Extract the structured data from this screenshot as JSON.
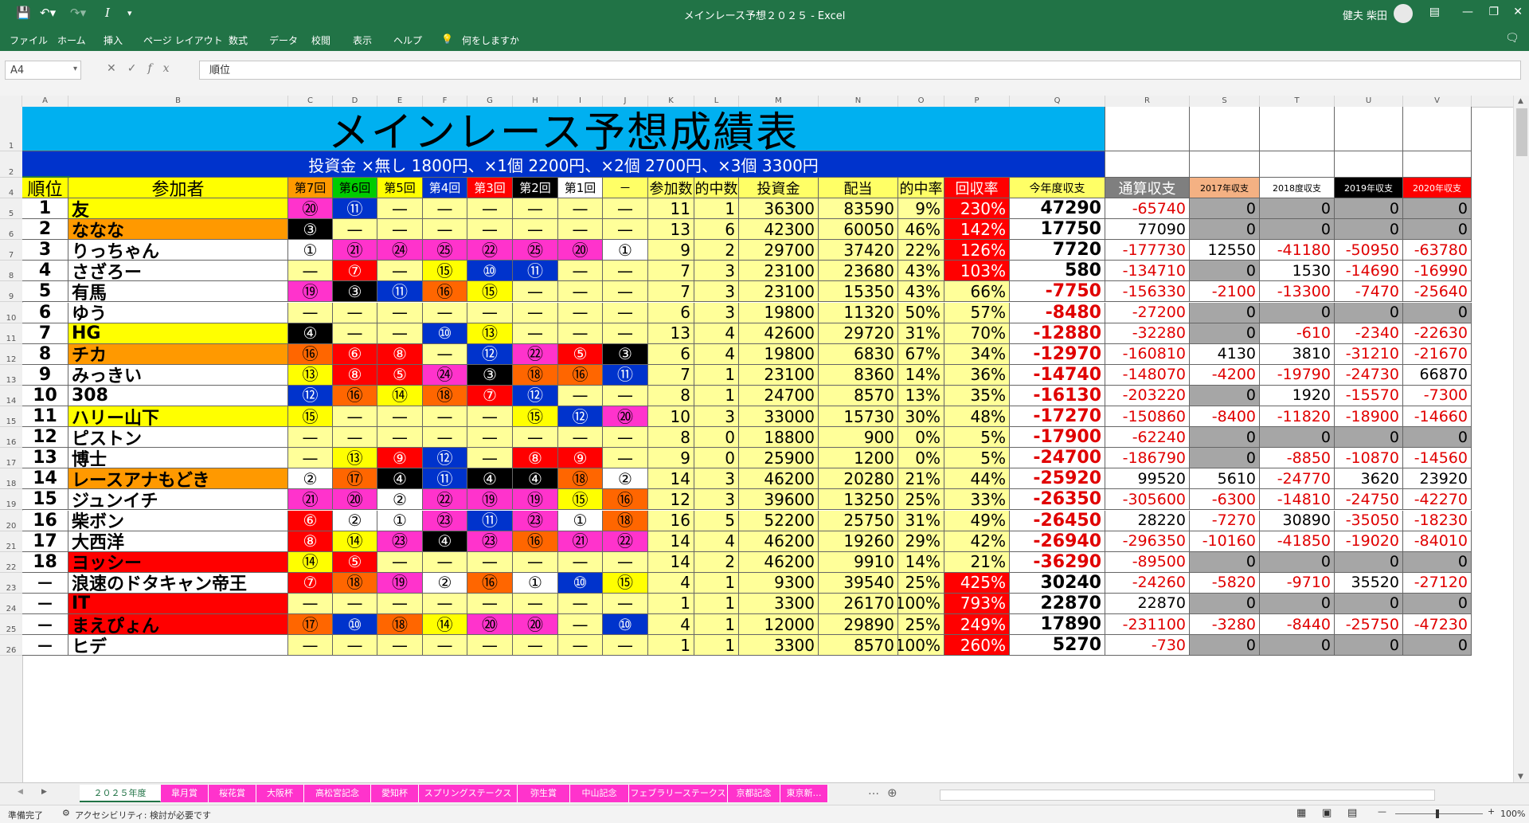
{
  "app": {
    "window_title": "メインレース予想２０２５ - Excel",
    "user_name": "健夫 柴田",
    "qa_icons": [
      "save-icon",
      "undo-icon",
      "redo-icon",
      "italic-icon",
      "customize-icon"
    ]
  },
  "ribbon": {
    "tabs": [
      "ファイル",
      "ホーム",
      "挿入",
      "ページ レイアウト",
      "数式",
      "データ",
      "校閲",
      "表示",
      "ヘルプ"
    ],
    "tell_me": "何をしますか"
  },
  "formula_bar": {
    "name_box": "A4",
    "content": "順位"
  },
  "columns": [
    {
      "l": "A",
      "w": 58
    },
    {
      "l": "B",
      "w": 276
    },
    {
      "l": "C",
      "w": 56
    },
    {
      "l": "D",
      "w": 56
    },
    {
      "l": "E",
      "w": 57
    },
    {
      "l": "F",
      "w": 56
    },
    {
      "l": "G",
      "w": 57
    },
    {
      "l": "H",
      "w": 57
    },
    {
      "l": "I",
      "w": 56
    },
    {
      "l": "J",
      "w": 57
    },
    {
      "l": "K",
      "w": 58
    },
    {
      "l": "L",
      "w": 56
    },
    {
      "l": "M",
      "w": 100
    },
    {
      "l": "N",
      "w": 100
    },
    {
      "l": "O",
      "w": 58
    },
    {
      "l": "P",
      "w": 82
    },
    {
      "l": "Q",
      "w": 120
    },
    {
      "l": "R",
      "w": 106
    },
    {
      "l": "S",
      "w": 88
    },
    {
      "l": "T",
      "w": 94
    },
    {
      "l": "U",
      "w": 86
    },
    {
      "l": "V",
      "w": 86
    }
  ],
  "row_numbers": [
    "1",
    "2",
    "4",
    "5",
    "6",
    "7",
    "8",
    "9",
    "10",
    "11",
    "12",
    "13",
    "14",
    "15",
    "16",
    "17",
    "18",
    "19",
    "20",
    "21",
    "22",
    "23",
    "24",
    "25",
    "26"
  ],
  "sheet_title": "メインレース予想成績表",
  "invest_line": "投資金 ×無し 1800円、×1個 2200円、×2個 2700円、×3個 3300円",
  "headers": [
    "順位",
    "参加者",
    "第7回",
    "第6回",
    "第5回",
    "第4回",
    "第3回",
    "第2回",
    "第1回",
    "－",
    "参加数",
    "的中数",
    "投資金",
    "配当",
    "的中率",
    "回収率",
    "今年度収支",
    "通算収支",
    "2017年収支",
    "2018度収支",
    "2019年収支",
    "2020年収支"
  ],
  "header_colors": {
    "bg": [
      "#ffff00",
      "#ffff00",
      "#ff9900",
      "#00cc00",
      "#ffff00",
      "#0033cc",
      "#ff0000",
      "#000000",
      "#ffffff",
      "#ffff66",
      "#ffff66",
      "#ffff66",
      "#ffff66",
      "#ffff66",
      "#ffff66",
      "#ff0000",
      "#ffff66",
      "#7f7f7f",
      "#f4b183",
      "#ffffff",
      "#000000",
      "#ff0000"
    ],
    "fg": [
      "#000000",
      "#000000",
      "#000000",
      "#000000",
      "#000000",
      "#ffffff",
      "#ffffff",
      "#ffffff",
      "#000000",
      "#000000",
      "#000000",
      "#000000",
      "#000000",
      "#000000",
      "#000000",
      "#ffffff",
      "#000000",
      "#ffffff",
      "#000000",
      "#000000",
      "#ffffff",
      "#ffffff"
    ]
  },
  "badge_colors": {
    "①": "#ffffff",
    "②": "#ffffff",
    "③": "#000000",
    "④": "#000000",
    "⑤": "#ff0000",
    "⑥": "#ff0000",
    "⑦": "#ff0000",
    "⑧": "#ff0000",
    "⑨": "#ff0000",
    "⑩": "#0033cc",
    "⑪": "#0033cc",
    "⑫": "#0033cc",
    "⑬": "#ffff00",
    "⑭": "#ffff00",
    "⑮": "#ffff00",
    "⑯": "#ff6600",
    "⑰": "#ff6600",
    "⑱": "#ff6600",
    "⑲": "#ff33cc",
    "⑳": "#ff33cc",
    "㉑": "#ff33cc",
    "㉒": "#ff33cc",
    "㉓": "#ff33cc",
    "㉔": "#ff33cc",
    "㉕": "#ff33cc"
  },
  "rows": [
    {
      "rank": "1",
      "name": "友",
      "name_bg": "#ffff00",
      "races": [
        "⑳",
        "⑪",
        "—",
        "—",
        "—",
        "—",
        "—",
        "—"
      ],
      "entries": "11",
      "hits": "1",
      "invest": "36300",
      "payout": "83590",
      "hit_rate": "9%",
      "recovery": "230%",
      "rec_red": true,
      "year": "47290",
      "total": "-65740",
      "y2017": "0",
      "y2018": "0",
      "y2019": "0",
      "y2020": "0",
      "grey": [
        1,
        1,
        1,
        1
      ]
    },
    {
      "rank": "2",
      "name": "ななな",
      "name_bg": "#ff9900",
      "races": [
        "③",
        "—",
        "—",
        "—",
        "—",
        "—",
        "—",
        "—"
      ],
      "entries": "13",
      "hits": "6",
      "invest": "42300",
      "payout": "60050",
      "hit_rate": "46%",
      "recovery": "142%",
      "rec_red": true,
      "year": "17750",
      "total": "77090",
      "y2017": "0",
      "y2018": "0",
      "y2019": "0",
      "y2020": "0",
      "grey": [
        1,
        1,
        1,
        1
      ]
    },
    {
      "rank": "3",
      "name": "りっちゃん",
      "name_bg": "#ffffff",
      "races": [
        "①",
        "㉑",
        "㉔",
        "㉕",
        "㉒",
        "㉕",
        "⑳",
        "①"
      ],
      "entries": "9",
      "hits": "2",
      "invest": "29700",
      "payout": "37420",
      "hit_rate": "22%",
      "recovery": "126%",
      "rec_red": true,
      "year": "7720",
      "total": "-177730",
      "y2017": "12550",
      "y2018": "-41180",
      "y2019": "-50950",
      "y2020": "-63780",
      "grey": [
        0,
        0,
        0,
        0
      ]
    },
    {
      "rank": "4",
      "name": "さざろー",
      "name_bg": "#ffffff",
      "races": [
        "—",
        "⑦",
        "—",
        "⑮",
        "⑩",
        "⑪",
        "—",
        "—"
      ],
      "entries": "7",
      "hits": "3",
      "invest": "23100",
      "payout": "23680",
      "hit_rate": "43%",
      "recovery": "103%",
      "rec_red": true,
      "year": "580",
      "total": "-134710",
      "y2017": "0",
      "y2018": "1530",
      "y2019": "-14690",
      "y2020": "-16990",
      "grey": [
        1,
        0,
        0,
        0
      ]
    },
    {
      "rank": "5",
      "name": "有馬",
      "name_bg": "#ffffff",
      "races": [
        "⑲",
        "③",
        "⑪",
        "⑯",
        "⑮",
        "—",
        "—",
        "—"
      ],
      "entries": "7",
      "hits": "3",
      "invest": "23100",
      "payout": "15350",
      "hit_rate": "43%",
      "recovery": "66%",
      "rec_red": false,
      "year": "-7750",
      "total": "-156330",
      "y2017": "-2100",
      "y2018": "-13300",
      "y2019": "-7470",
      "y2020": "-25640",
      "grey": [
        0,
        0,
        0,
        0
      ]
    },
    {
      "rank": "6",
      "name": "ゆう",
      "name_bg": "#ffffff",
      "races": [
        "—",
        "—",
        "—",
        "—",
        "—",
        "—",
        "—",
        "—"
      ],
      "entries": "6",
      "hits": "3",
      "invest": "19800",
      "payout": "11320",
      "hit_rate": "50%",
      "recovery": "57%",
      "rec_red": false,
      "year": "-8480",
      "total": "-27200",
      "y2017": "0",
      "y2018": "0",
      "y2019": "0",
      "y2020": "0",
      "grey": [
        1,
        1,
        1,
        1
      ]
    },
    {
      "rank": "7",
      "name": "HG",
      "name_bg": "#ffff00",
      "races": [
        "④",
        "—",
        "—",
        "⑩",
        "⑬",
        "—",
        "—",
        "—"
      ],
      "entries": "13",
      "hits": "4",
      "invest": "42600",
      "payout": "29720",
      "hit_rate": "31%",
      "recovery": "70%",
      "rec_red": false,
      "year": "-12880",
      "total": "-32280",
      "y2017": "0",
      "y2018": "-610",
      "y2019": "-2340",
      "y2020": "-22630",
      "grey": [
        1,
        0,
        0,
        0
      ]
    },
    {
      "rank": "8",
      "name": "チカ",
      "name_bg": "#ff9900",
      "races": [
        "⑯",
        "⑥",
        "⑧",
        "—",
        "⑫",
        "㉒",
        "⑤",
        "③"
      ],
      "entries": "6",
      "hits": "4",
      "invest": "19800",
      "payout": "6830",
      "hit_rate": "67%",
      "recovery": "34%",
      "rec_red": false,
      "year": "-12970",
      "total": "-160810",
      "y2017": "4130",
      "y2018": "3810",
      "y2019": "-31210",
      "y2020": "-21670",
      "grey": [
        0,
        0,
        0,
        0
      ]
    },
    {
      "rank": "9",
      "name": "みっきい",
      "name_bg": "#ffffff",
      "races": [
        "⑬",
        "⑧",
        "⑤",
        "㉔",
        "③",
        "⑱",
        "⑯",
        "⑪"
      ],
      "entries": "7",
      "hits": "1",
      "invest": "23100",
      "payout": "8360",
      "hit_rate": "14%",
      "recovery": "36%",
      "rec_red": false,
      "year": "-14740",
      "total": "-148070",
      "y2017": "-4200",
      "y2018": "-19790",
      "y2019": "-24730",
      "y2020": "66870",
      "grey": [
        0,
        0,
        0,
        0
      ]
    },
    {
      "rank": "10",
      "name": "308",
      "name_bg": "#ffffff",
      "races": [
        "⑫",
        "⑯",
        "⑭",
        "⑱",
        "⑦",
        "⑫",
        "—",
        "—"
      ],
      "entries": "8",
      "hits": "1",
      "invest": "24700",
      "payout": "8570",
      "hit_rate": "13%",
      "recovery": "35%",
      "rec_red": false,
      "year": "-16130",
      "total": "-203220",
      "y2017": "0",
      "y2018": "1920",
      "y2019": "-15570",
      "y2020": "-7300",
      "grey": [
        1,
        0,
        0,
        0
      ]
    },
    {
      "rank": "11",
      "name": "ハリー山下",
      "name_bg": "#ffff00",
      "races": [
        "⑮",
        "—",
        "—",
        "—",
        "—",
        "⑮",
        "⑫",
        "⑳"
      ],
      "entries": "10",
      "hits": "3",
      "invest": "33000",
      "payout": "15730",
      "hit_rate": "30%",
      "recovery": "48%",
      "rec_red": false,
      "year": "-17270",
      "total": "-150860",
      "y2017": "-8400",
      "y2018": "-11820",
      "y2019": "-18900",
      "y2020": "-14660",
      "grey": [
        0,
        0,
        0,
        0
      ]
    },
    {
      "rank": "12",
      "name": "ピストン",
      "name_bg": "#ffffff",
      "races": [
        "—",
        "—",
        "—",
        "—",
        "—",
        "—",
        "—",
        "—"
      ],
      "entries": "8",
      "hits": "0",
      "invest": "18800",
      "payout": "900",
      "hit_rate": "0%",
      "recovery": "5%",
      "rec_red": false,
      "year": "-17900",
      "total": "-62240",
      "y2017": "0",
      "y2018": "0",
      "y2019": "0",
      "y2020": "0",
      "grey": [
        1,
        1,
        1,
        1
      ]
    },
    {
      "rank": "13",
      "name": "博士",
      "name_bg": "#ffffff",
      "races": [
        "—",
        "⑬",
        "⑨",
        "⑫",
        "—",
        "⑧",
        "⑨",
        "—"
      ],
      "entries": "9",
      "hits": "0",
      "invest": "25900",
      "payout": "1200",
      "hit_rate": "0%",
      "recovery": "5%",
      "rec_red": false,
      "year": "-24700",
      "total": "-186790",
      "y2017": "0",
      "y2018": "-8850",
      "y2019": "-10870",
      "y2020": "-14560",
      "grey": [
        1,
        0,
        0,
        0
      ]
    },
    {
      "rank": "14",
      "name": "レースアナもどき",
      "name_bg": "#ff9900",
      "races": [
        "②",
        "⑰",
        "④",
        "⑪",
        "④",
        "④",
        "⑱",
        "②"
      ],
      "entries": "14",
      "hits": "3",
      "invest": "46200",
      "payout": "20280",
      "hit_rate": "21%",
      "recovery": "44%",
      "rec_red": false,
      "year": "-25920",
      "total": "99520",
      "y2017": "5610",
      "y2018": "-24770",
      "y2019": "3620",
      "y2020": "23920",
      "grey": [
        0,
        0,
        0,
        0
      ]
    },
    {
      "rank": "15",
      "name": "ジュンイチ",
      "name_bg": "#ffffff",
      "races": [
        "㉑",
        "⑳",
        "②",
        "㉒",
        "⑲",
        "⑲",
        "⑮",
        "⑯"
      ],
      "entries": "12",
      "hits": "3",
      "invest": "39600",
      "payout": "13250",
      "hit_rate": "25%",
      "recovery": "33%",
      "rec_red": false,
      "year": "-26350",
      "total": "-305600",
      "y2017": "-6300",
      "y2018": "-14810",
      "y2019": "-24750",
      "y2020": "-42270",
      "grey": [
        0,
        0,
        0,
        0
      ]
    },
    {
      "rank": "16",
      "name": "柴ボン",
      "name_bg": "#ffffff",
      "races": [
        "⑥",
        "②",
        "①",
        "㉓",
        "⑪",
        "㉓",
        "①",
        "⑱"
      ],
      "entries": "16",
      "hits": "5",
      "invest": "52200",
      "payout": "25750",
      "hit_rate": "31%",
      "recovery": "49%",
      "rec_red": false,
      "year": "-26450",
      "total": "28220",
      "y2017": "-7270",
      "y2018": "30890",
      "y2019": "-35050",
      "y2020": "-18230",
      "grey": [
        0,
        0,
        0,
        0
      ]
    },
    {
      "rank": "17",
      "name": "大西洋",
      "name_bg": "#ffffff",
      "races": [
        "⑧",
        "⑭",
        "㉓",
        "④",
        "㉓",
        "⑯",
        "㉑",
        "㉒"
      ],
      "entries": "14",
      "hits": "4",
      "invest": "46200",
      "payout": "19260",
      "hit_rate": "29%",
      "recovery": "42%",
      "rec_red": false,
      "year": "-26940",
      "total": "-296350",
      "y2017": "-10160",
      "y2018": "-41850",
      "y2019": "-19020",
      "y2020": "-84010",
      "grey": [
        0,
        0,
        0,
        0
      ]
    },
    {
      "rank": "18",
      "name": "ヨッシー",
      "name_bg": "#ff0000",
      "races": [
        "⑭",
        "⑤",
        "—",
        "—",
        "—",
        "—",
        "—",
        "—"
      ],
      "entries": "14",
      "hits": "2",
      "invest": "46200",
      "payout": "9910",
      "hit_rate": "14%",
      "recovery": "21%",
      "rec_red": false,
      "year": "-36290",
      "total": "-89500",
      "y2017": "0",
      "y2018": "0",
      "y2019": "0",
      "y2020": "0",
      "grey": [
        1,
        1,
        1,
        1
      ]
    },
    {
      "rank": "－",
      "name": "浪速のドタキャン帝王",
      "name_bg": "#ffffff",
      "races": [
        "⑦",
        "⑱",
        "⑲",
        "②",
        "⑯",
        "①",
        "⑩",
        "⑮"
      ],
      "entries": "4",
      "hits": "1",
      "invest": "9300",
      "payout": "39540",
      "hit_rate": "25%",
      "recovery": "425%",
      "rec_red": true,
      "year": "30240",
      "total": "-24260",
      "y2017": "-5820",
      "y2018": "-9710",
      "y2019": "35520",
      "y2020": "-27120",
      "grey": [
        0,
        0,
        0,
        0
      ]
    },
    {
      "rank": "－",
      "name": "IT",
      "name_bg": "#ff0000",
      "races": [
        "—",
        "—",
        "—",
        "—",
        "—",
        "—",
        "—",
        "—"
      ],
      "entries": "1",
      "hits": "1",
      "invest": "3300",
      "payout": "26170",
      "hit_rate": "100%",
      "recovery": "793%",
      "rec_red": true,
      "year": "22870",
      "total": "22870",
      "y2017": "0",
      "y2018": "0",
      "y2019": "0",
      "y2020": "0",
      "grey": [
        1,
        1,
        1,
        1
      ]
    },
    {
      "rank": "－",
      "name": "まえぴょん",
      "name_bg": "#ff0000",
      "races": [
        "⑰",
        "⑩",
        "⑱",
        "⑭",
        "⑳",
        "⑳",
        "—",
        "⑩"
      ],
      "entries": "4",
      "hits": "1",
      "invest": "12000",
      "payout": "29890",
      "hit_rate": "25%",
      "recovery": "249%",
      "rec_red": true,
      "year": "17890",
      "total": "-231100",
      "y2017": "-3280",
      "y2018": "-8440",
      "y2019": "-25750",
      "y2020": "-47230",
      "grey": [
        0,
        0,
        0,
        0
      ]
    },
    {
      "rank": "－",
      "name": "ヒデ",
      "name_bg": "#ffffff",
      "races": [
        "—",
        "—",
        "—",
        "—",
        "—",
        "—",
        "—",
        "—"
      ],
      "entries": "1",
      "hits": "1",
      "invest": "3300",
      "payout": "8570",
      "hit_rate": "100%",
      "recovery": "260%",
      "rec_red": true,
      "year": "5270",
      "total": "-730",
      "y2017": "0",
      "y2018": "0",
      "y2019": "0",
      "y2020": "0",
      "grey": [
        1,
        1,
        1,
        1
      ]
    }
  ],
  "sheet_tabs": [
    "２０２５年度",
    "皐月賞",
    "桜花賞",
    "大阪杯",
    "高松宮記念",
    "愛知杯",
    "スプリングステークス",
    "弥生賞",
    "中山記念",
    "フェブラリーステークス",
    "京都記念",
    "東京新…"
  ],
  "status": {
    "ready": "準備完了",
    "accessibility": "アクセシビリティ: 検討が必要です",
    "zoom": "100%"
  }
}
